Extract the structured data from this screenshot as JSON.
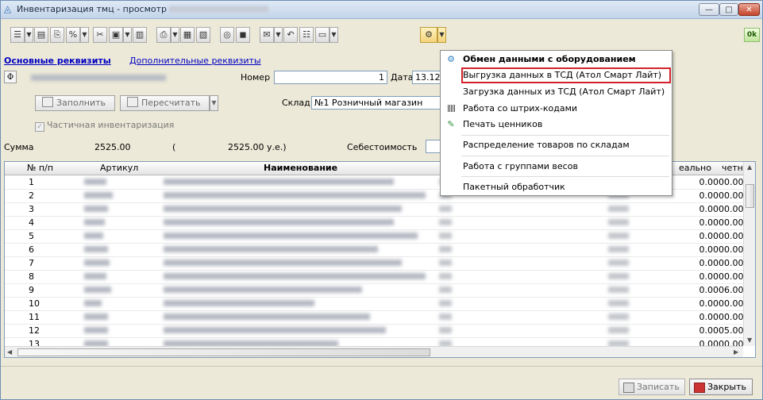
{
  "window": {
    "title": "Инвентаризация тмц - просмотр -",
    "min": "—",
    "max": "□",
    "close": "✕"
  },
  "toolbar": {
    "ok_label": "0k"
  },
  "form": {
    "tab_main": "Основные реквизиты",
    "tab_extra": "Дополнительные реквизиты",
    "phi_label": "Ф",
    "number_label": "Номер",
    "number_value": "1",
    "date_label": "Дата",
    "date_value": "13.12",
    "fill_button": "Заполнить",
    "recalc_button": "Пересчитать",
    "warehouse_label": "Склад",
    "warehouse_value": "№1 Розничный магазин",
    "partial_label": "Частичная инвентаризация",
    "sum_label": "Сумма",
    "sum_value": "2525.00",
    "sum_paren_open": "(",
    "sum_ue": "2525.00  у.е.)",
    "cost_label": "Себестоимость"
  },
  "grid": {
    "headers": {
      "num": "№ п/п",
      "article": "Артикул",
      "name": "Наименование",
      "actual": "еально",
      "accounting": "четн:"
    },
    "rows": [
      {
        "n": "1",
        "v1": "0.000",
        "v2": "0.00"
      },
      {
        "n": "2",
        "v1": "0.000",
        "v2": "0.00"
      },
      {
        "n": "3",
        "v1": "0.000",
        "v2": "0.00"
      },
      {
        "n": "4",
        "v1": "0.000",
        "v2": "0.00"
      },
      {
        "n": "5",
        "v1": "0.000",
        "v2": "0.00"
      },
      {
        "n": "6",
        "v1": "0.000",
        "v2": "0.00"
      },
      {
        "n": "7",
        "v1": "0.000",
        "v2": "0.00"
      },
      {
        "n": "8",
        "v1": "0.000",
        "v2": "0.00"
      },
      {
        "n": "9",
        "v1": "0.000",
        "v2": "6.00"
      },
      {
        "n": "10",
        "v1": "0.000",
        "v2": "0.00"
      },
      {
        "n": "11",
        "v1": "0.000",
        "v2": "0.00"
      },
      {
        "n": "12",
        "v1": "0.000",
        "v2": "5.00"
      },
      {
        "n": "13",
        "v1": "0.000",
        "v2": "0.00"
      }
    ]
  },
  "menu": {
    "items": [
      {
        "label": "Обмен данными с оборудованием",
        "icon": "equipment-icon"
      },
      {
        "label": "Выгрузка данных в ТСД (Атол Смарт Лайт)",
        "icon": ""
      },
      {
        "label": "Загрузка данных из ТСД (Атол Смарт Лайт)",
        "icon": ""
      },
      {
        "label": "Работа со штрих-кодами",
        "icon": "barcode-icon"
      },
      {
        "label": "Печать ценников",
        "icon": "price-tag-icon"
      },
      {
        "label": "Распределение товаров по складам",
        "icon": ""
      },
      {
        "label": "Работа с группами весов",
        "icon": ""
      },
      {
        "label": "Пакетный обработчик",
        "icon": ""
      }
    ]
  },
  "bottom": {
    "save_button": "Записать",
    "close_button": "Закрыть"
  },
  "colors": {
    "highlight_border": "#d2232a",
    "link": "#0000c0"
  }
}
